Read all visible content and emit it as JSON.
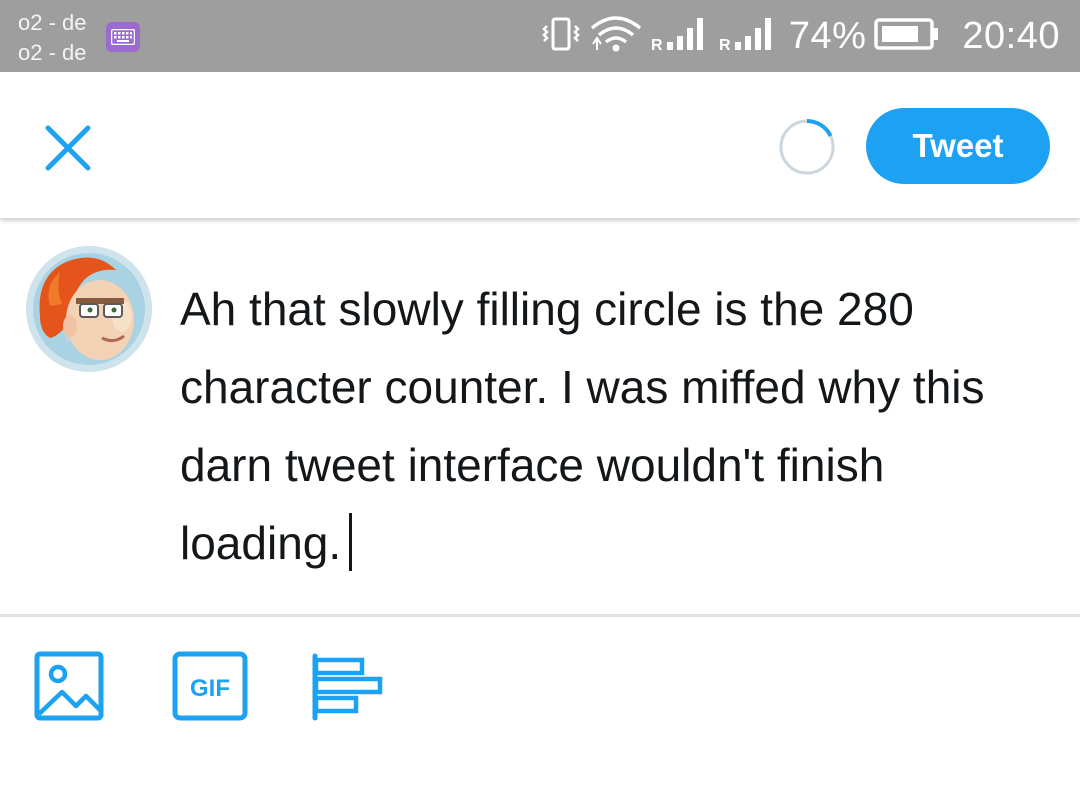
{
  "status_bar": {
    "carrier_line1": "o2 - de",
    "carrier_line2": "o2 - de",
    "roaming_label_1": "R",
    "roaming_label_2": "R",
    "battery_percent": "74%",
    "time": "20:40"
  },
  "header": {
    "tweet_button_label": "Tweet",
    "character_counter_fill": 0.18
  },
  "compose": {
    "text": "Ah that slowly filling circle is the 280 character counter. I was miffed why this darn tweet interface wouldn't finish loading."
  },
  "toolbar": {
    "gif_label": "GIF"
  },
  "colors": {
    "accent": "#1da1f2",
    "status_bar": "#9e9e9e",
    "text": "#14171a",
    "ring_track": "#ccd6dd"
  }
}
